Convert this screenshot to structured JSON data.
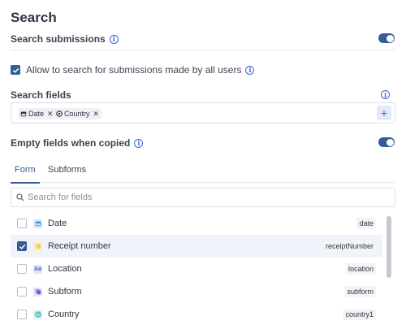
{
  "header": {
    "title": "Search"
  },
  "search_submissions": {
    "label": "Search submissions",
    "enabled": true
  },
  "allow_all_users": {
    "label": "Allow to search for submissions made by all users",
    "checked": true
  },
  "search_fields": {
    "label": "Search fields",
    "chips": [
      {
        "label": "Date",
        "icon": "calendar-icon"
      },
      {
        "label": "Country",
        "icon": "globe-icon"
      }
    ],
    "add_label": "+"
  },
  "empty_fields": {
    "label": "Empty fields when copied",
    "enabled": true
  },
  "tabs": [
    {
      "label": "Form",
      "active": true
    },
    {
      "label": "Subforms",
      "active": false
    }
  ],
  "field_search": {
    "placeholder": "Search for fields",
    "value": ""
  },
  "fields": [
    {
      "name": "Date",
      "code": "date",
      "checked": false,
      "icon": "calendar-icon",
      "color": "#2f8fd8"
    },
    {
      "name": "Receipt number",
      "code": "receiptNumber",
      "checked": true,
      "icon": "list-icon",
      "color": "#e9b53a"
    },
    {
      "name": "Location",
      "code": "location",
      "checked": false,
      "icon": "text-icon",
      "color": "#3d63c9"
    },
    {
      "name": "Subform",
      "code": "subform",
      "checked": false,
      "icon": "subform-icon",
      "color": "#6b5bd6"
    },
    {
      "name": "Country",
      "code": "country1",
      "checked": false,
      "icon": "globe-icon",
      "color": "#2bb5a8"
    }
  ],
  "colors": {
    "accent": "#355c96",
    "info": "#3d63c9"
  }
}
